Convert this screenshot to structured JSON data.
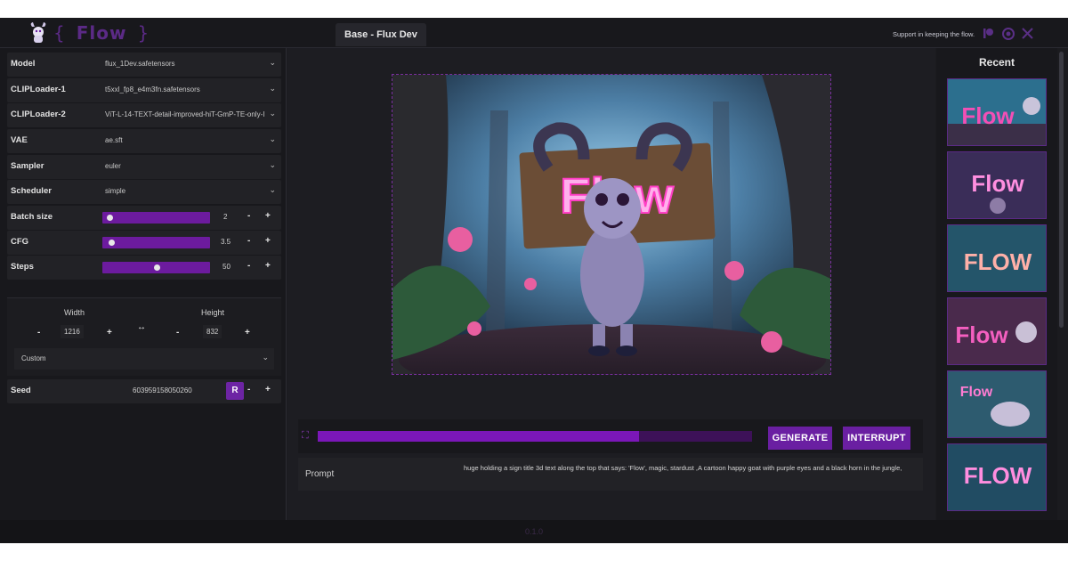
{
  "header": {
    "brand_open": "{",
    "brand_word": "Flow",
    "brand_close": "}",
    "active_tab": "Base - Flux Dev",
    "support_text": "Support in keeping the flow.",
    "icons": [
      "patreon-icon",
      "github-icon",
      "x-icon"
    ]
  },
  "settings": {
    "model": {
      "label": "Model",
      "value": "flux_1Dev.safetensors"
    },
    "clip1": {
      "label": "CLIPLoader-1",
      "value": "t5xxl_fp8_e4m3fn.safetensors"
    },
    "clip2": {
      "label": "CLIPLoader-2",
      "value": "ViT-L-14-TEXT-detail-improved-hiT-GmP-TE-only-I"
    },
    "vae": {
      "label": "VAE",
      "value": "ae.sft"
    },
    "sampler": {
      "label": "Sampler",
      "value": "euler"
    },
    "scheduler": {
      "label": "Scheduler",
      "value": "simple"
    },
    "batch": {
      "label": "Batch size",
      "value": "2",
      "minus": "-",
      "plus": "+"
    },
    "cfg": {
      "label": "CFG",
      "value": "3.5",
      "minus": "-",
      "plus": "+"
    },
    "steps": {
      "label": "Steps",
      "value": "50",
      "minus": "-",
      "plus": "+"
    },
    "width": {
      "label": "Width",
      "value": "1216",
      "minus": "-",
      "plus": "+"
    },
    "height": {
      "label": "Height",
      "value": "832",
      "minus": "-",
      "plus": "+"
    },
    "swap_symbol": "↔",
    "aspect": "Custom",
    "seed": {
      "label": "Seed",
      "value": "603959158050260",
      "random": "R",
      "minus": "-",
      "plus": "+"
    }
  },
  "generation": {
    "progress": 0.74,
    "generate_label": "GENERATE",
    "interrupt_label": "INTERRUPT",
    "prompt_label": "Prompt",
    "prompt_text": "huge holding a sign title 3d text along the top that says: 'Flow', magic, stardust ,A cartoon happy goat with purple eyes and a black horn in the jungle,"
  },
  "recent": {
    "title": "Recent",
    "thumbs": [
      "Flow",
      "Flow",
      "FLOW",
      "Flow",
      "Flow",
      "FLOW"
    ]
  },
  "image": {
    "sign_text": "Flow"
  },
  "footer": {
    "version": "0.1.0"
  },
  "colors": {
    "accent": "#6a1fa2",
    "progress_bg": "#3d1158",
    "bg": "#1b1b1f"
  }
}
